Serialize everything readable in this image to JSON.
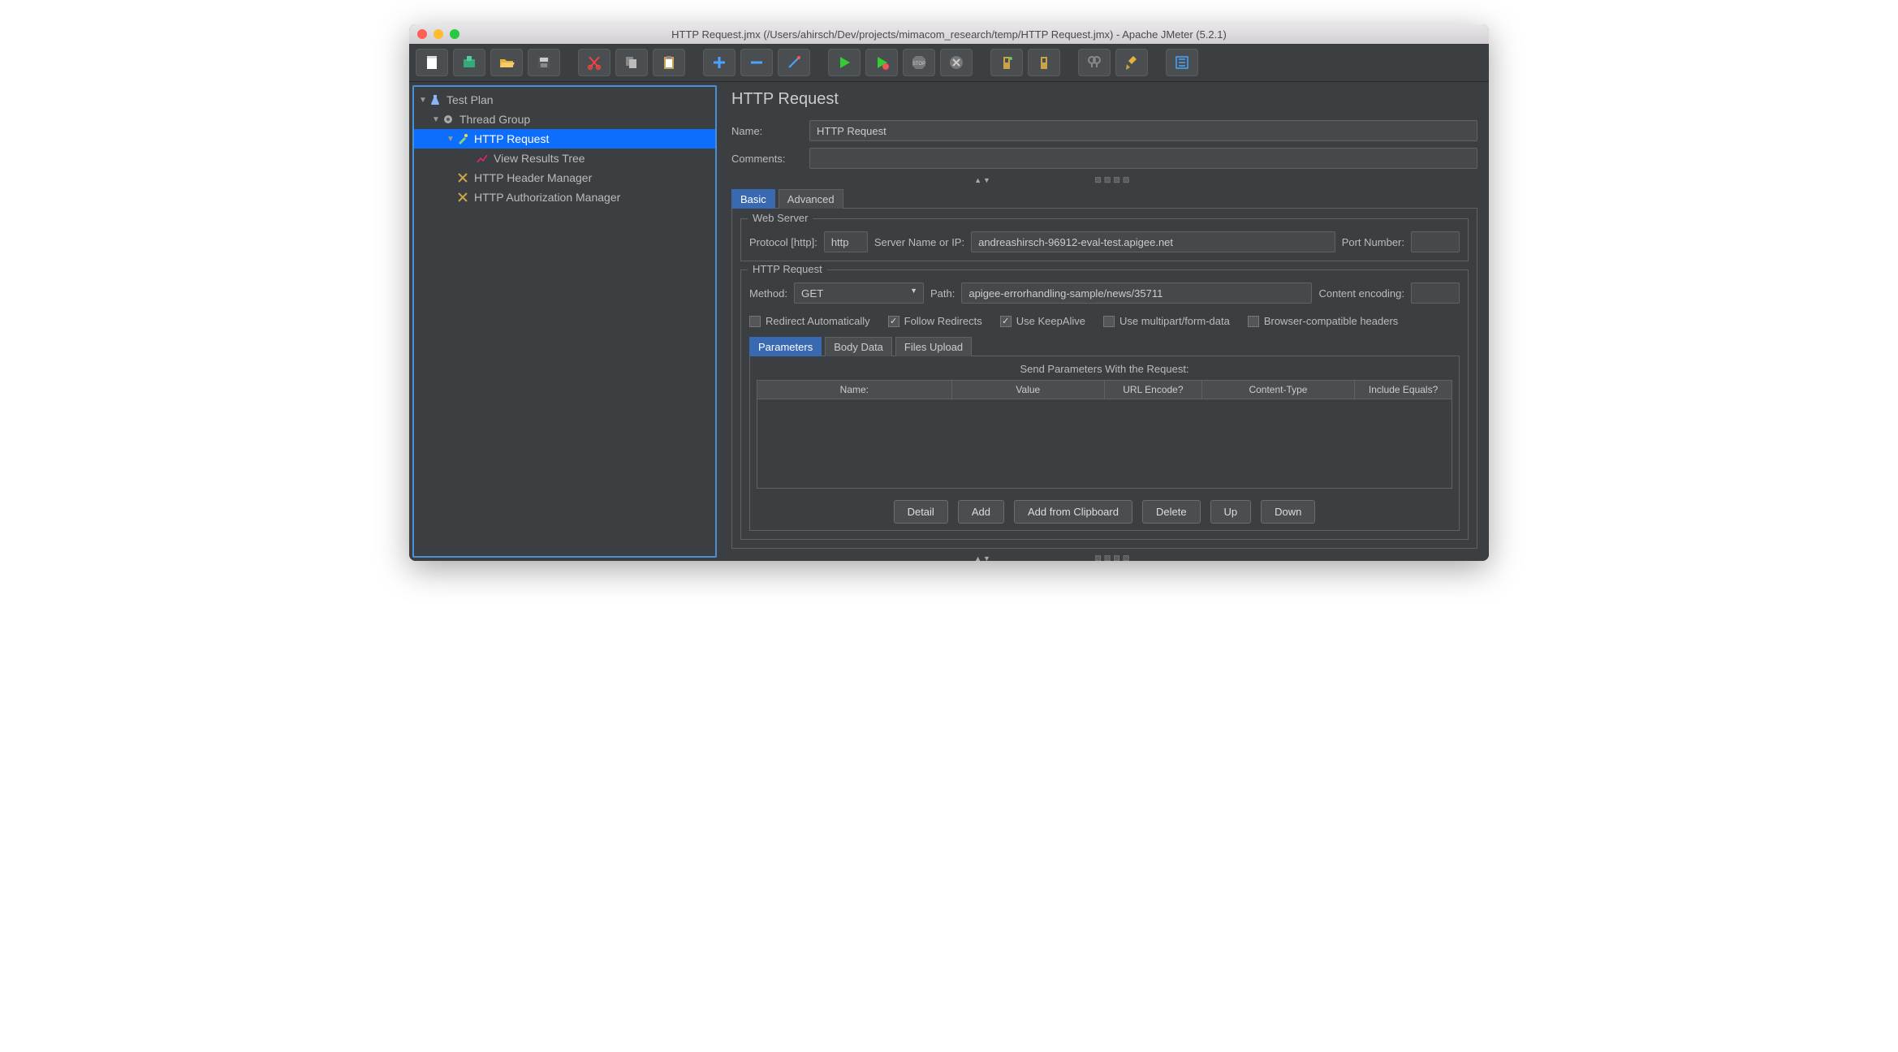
{
  "window": {
    "title": "HTTP Request.jmx (/Users/ahirsch/Dev/projects/mimacom_research/temp/HTTP Request.jmx) - Apache JMeter (5.2.1)"
  },
  "toolbar_icons": [
    "new",
    "templates",
    "open",
    "save",
    "cut",
    "copy",
    "paste",
    "add",
    "remove",
    "wand",
    "start",
    "start-notimer",
    "stop",
    "shutdown",
    "clear",
    "clear-all",
    "search",
    "broom",
    "toggle"
  ],
  "tree": {
    "root": "Test Plan",
    "thread_group": "Thread Group",
    "http_request": "HTTP Request",
    "view_results": "View Results Tree",
    "header_mgr": "HTTP Header Manager",
    "auth_mgr": "HTTP Authorization Manager"
  },
  "panel": {
    "title": "HTTP Request",
    "name_label": "Name:",
    "name_value": "HTTP Request",
    "comments_label": "Comments:",
    "comments_value": "",
    "tabs": {
      "basic": "Basic",
      "advanced": "Advanced"
    },
    "web_server": {
      "legend": "Web Server",
      "protocol_label": "Protocol [http]:",
      "protocol_value": "http",
      "server_label": "Server Name or IP:",
      "server_value": "andreashirsch-96912-eval-test.apigee.net",
      "port_label": "Port Number:",
      "port_value": ""
    },
    "http_request": {
      "legend": "HTTP Request",
      "method_label": "Method:",
      "method_value": "GET",
      "path_label": "Path:",
      "path_value": "apigee-errorhandling-sample/news/35711",
      "encoding_label": "Content encoding:",
      "encoding_value": ""
    },
    "checkboxes": {
      "redirect_auto": {
        "label": "Redirect Automatically",
        "checked": false
      },
      "follow_redirects": {
        "label": "Follow Redirects",
        "checked": true
      },
      "keepalive": {
        "label": "Use KeepAlive",
        "checked": true
      },
      "multipart": {
        "label": "Use multipart/form-data",
        "checked": false
      },
      "browser_compat": {
        "label": "Browser-compatible headers",
        "checked": false
      }
    },
    "param_tabs": {
      "parameters": "Parameters",
      "body": "Body Data",
      "files": "Files Upload"
    },
    "param_table": {
      "title": "Send Parameters With the Request:",
      "cols": {
        "name": "Name:",
        "value": "Value",
        "urlenc": "URL Encode?",
        "ctype": "Content-Type",
        "inceq": "Include Equals?"
      }
    },
    "buttons": {
      "detail": "Detail",
      "add": "Add",
      "clipboard": "Add from Clipboard",
      "delete": "Delete",
      "up": "Up",
      "down": "Down"
    }
  }
}
